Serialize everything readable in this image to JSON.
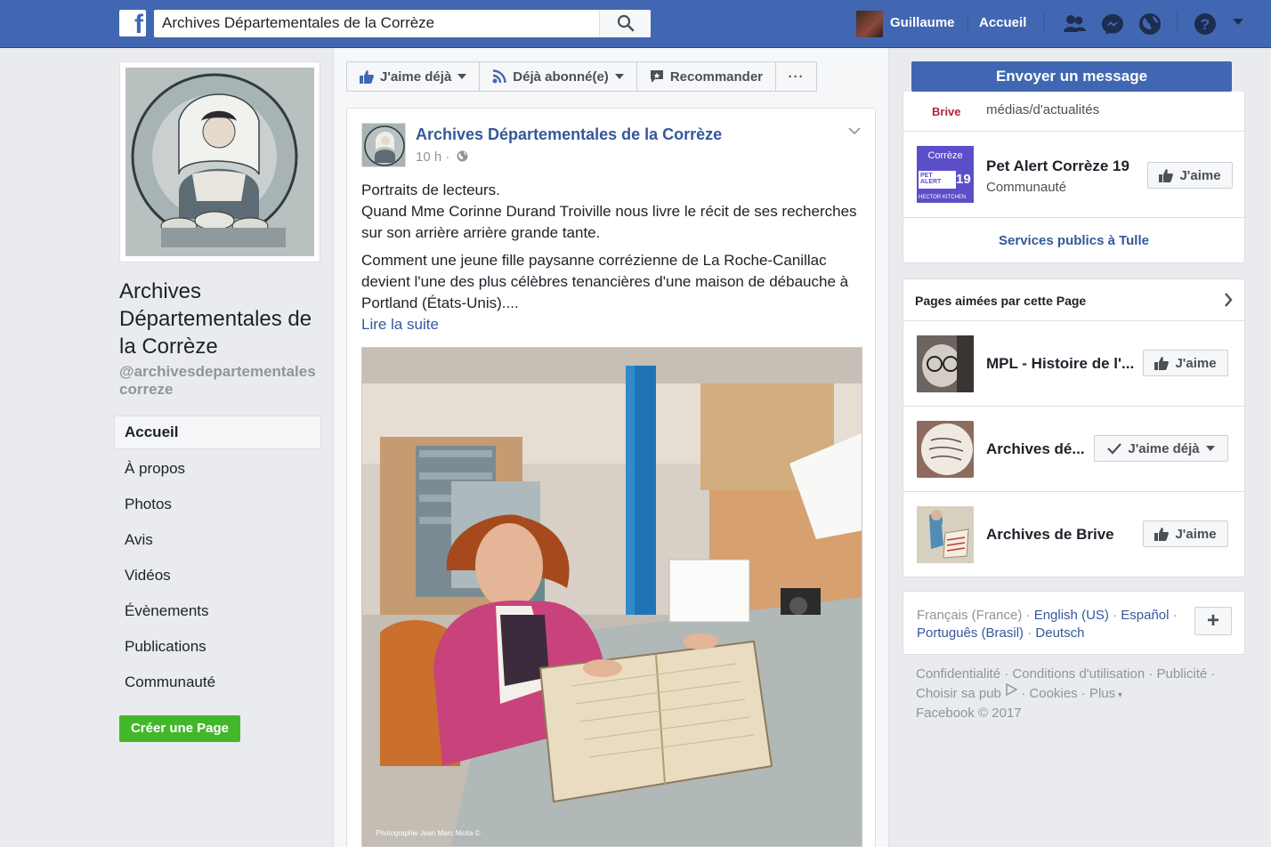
{
  "topbar": {
    "logo": "f",
    "search_value": "Archives Départementales de la Corrèze",
    "user_name": "Guillaume",
    "home_link": "Accueil",
    "icons": [
      "friend-requests-icon",
      "messenger-icon",
      "notifications-globe-icon",
      "help-icon",
      "caret-down-icon"
    ]
  },
  "page": {
    "title": "Archives Départementales de la Corrèze",
    "handle": "@archivesdepartementalescorreze"
  },
  "nav": {
    "items": [
      "Accueil",
      "À propos",
      "Photos",
      "Avis",
      "Vidéos",
      "Évènements",
      "Publications",
      "Communauté"
    ],
    "active_index": 0,
    "create_page": "Créer une Page"
  },
  "actions": {
    "like": "J'aime déjà",
    "follow": "Déjà abonné(e)",
    "recommend": "Recommander",
    "more": "···"
  },
  "post": {
    "author": "Archives Départementales de la Corrèze",
    "time": "10 h ·",
    "paragraph1": "Portraits de lecteurs.\nQuand Mme Corinne Durand Troiville nous livre le récit de ses recherches sur son arrière arrière grande tante.",
    "paragraph2": "Comment une jeune fille paysanne corrézienne de La Roche-Canillac devient l'une des plus célèbres tenancières d'une maison de débauche à Portland (États-Unis)....",
    "read_more": "Lire la suite",
    "photo_credit": "Photographie Jean Marc Nicita ©"
  },
  "right": {
    "send_message": "Envoyer un message",
    "partial_row": {
      "thumb_text": "Brive",
      "name": "médias/d'actualités"
    },
    "pet_alert": {
      "name": "Pet Alert Corrèze 19",
      "category": "Communauté",
      "thumb_top": "Corrèze",
      "thumb_mid": "PET ALERT",
      "thumb_num": "19",
      "thumb_bottom": "HECTOR KITCHEN",
      "button": "J'aime"
    },
    "services_link": "Services publics à Tulle",
    "liked_pages_header": "Pages aimées par cette Page",
    "liked_pages": [
      {
        "name": "MPL - Histoire de l'...",
        "button": "J'aime"
      },
      {
        "name": "Archives dé...",
        "button": "J'aime déjà"
      },
      {
        "name": "Archives de Brive",
        "button": "J'aime"
      }
    ],
    "languages": {
      "current": "Français (France)",
      "others": [
        "English (US)",
        "Español",
        "Português (Brasil)",
        "Deutsch"
      ],
      "plus": "+"
    },
    "footer": "Confidentialité · Conditions d'utilisation · Publicité · Choisir sa pub · Cookies · Plus · Facebook © 2017",
    "footer_parts": [
      "Confidentialité",
      "Conditions d'utilisation",
      "Publicité",
      "Choisir sa pub",
      "Cookies",
      "Plus",
      "Facebook © 2017"
    ]
  },
  "colors": {
    "brand_blue": "#4267b2",
    "link_blue": "#365899",
    "green": "#42b72a",
    "background": "#e9ebee"
  }
}
